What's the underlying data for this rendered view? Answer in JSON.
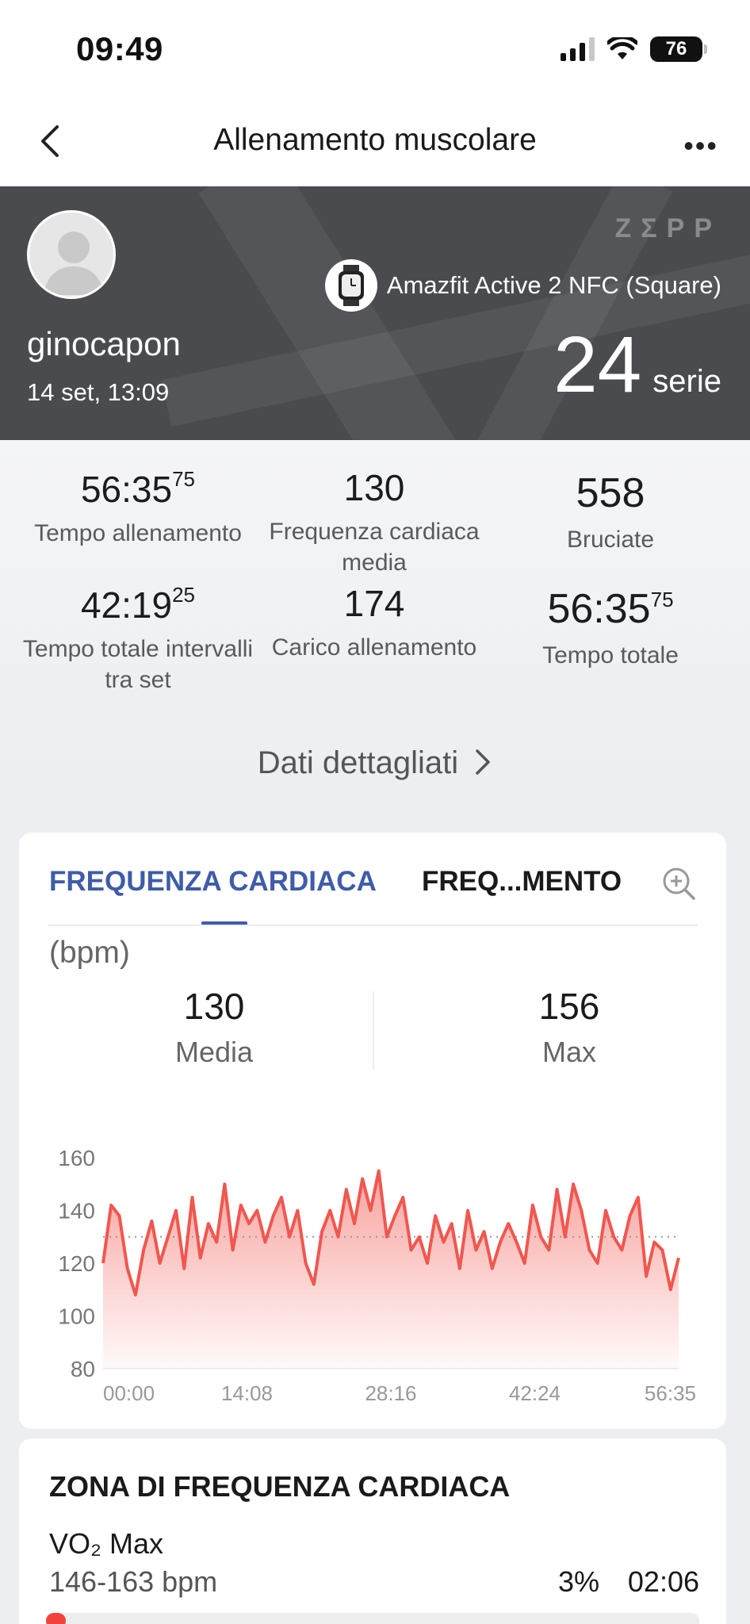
{
  "status": {
    "time": "09:49",
    "battery": "76"
  },
  "nav": {
    "title": "Allenamento muscolare"
  },
  "hero": {
    "username": "ginocapon",
    "date": "14 set, 13:09",
    "brand": "ZΣPP",
    "device": "Amazfit Active 2 NFC (Square)",
    "sets_value": "24",
    "sets_unit": "serie"
  },
  "stats": [
    {
      "value": "56:35",
      "sup": "75",
      "label": "Tempo allenamento"
    },
    {
      "value": "130",
      "sup": "",
      "label": "Frequenza cardiaca media"
    },
    {
      "value": "558",
      "sup": "",
      "label": "Bruciate"
    },
    {
      "value": "42:19",
      "sup": "25",
      "label": "Tempo totale intervalli tra set"
    },
    {
      "value": "174",
      "sup": "",
      "label": "Carico allenamento"
    },
    {
      "value": "56:35",
      "sup": "75",
      "label": "Tempo totale"
    }
  ],
  "details_link": "Dati dettagliati",
  "hr_card": {
    "tab_hr": "FREQUENZA CARDIACA",
    "tab_load": "FREQ...MENTO",
    "unit": "(bpm)",
    "avg_value": "130",
    "avg_label": "Media",
    "max_value": "156",
    "max_label": "Max"
  },
  "chart_data": {
    "type": "area",
    "title": "",
    "xlabel": "",
    "ylabel": "(bpm)",
    "ylim": [
      80,
      160
    ],
    "yticks": [
      "80",
      "100",
      "120",
      "140",
      "160"
    ],
    "xticks": [
      "00:00",
      "14:08",
      "28:16",
      "42:24",
      "56:35"
    ],
    "average_line": 130,
    "grid": false,
    "color": "#f0574f",
    "series": [
      {
        "name": "",
        "values": [
          120,
          142,
          138,
          118,
          108,
          125,
          136,
          120,
          130,
          140,
          118,
          145,
          122,
          135,
          128,
          150,
          125,
          142,
          135,
          140,
          128,
          138,
          145,
          130,
          140,
          120,
          112,
          132,
          140,
          130,
          148,
          135,
          152,
          140,
          155,
          130,
          138,
          145,
          125,
          130,
          120,
          138,
          128,
          135,
          118,
          140,
          125,
          132,
          118,
          128,
          135,
          128,
          120,
          142,
          130,
          125,
          148,
          130,
          150,
          140,
          125,
          120,
          140,
          130,
          125,
          138,
          145,
          115,
          128,
          125,
          110,
          122
        ]
      }
    ]
  },
  "zone_card": {
    "title": "ZONA DI FREQUENZA CARDIACA",
    "zone_name": "VO₂ Max",
    "zone_range": "146-163 bpm",
    "zone_pct": "3%",
    "zone_pct_value": 3,
    "zone_time": "02:06"
  }
}
